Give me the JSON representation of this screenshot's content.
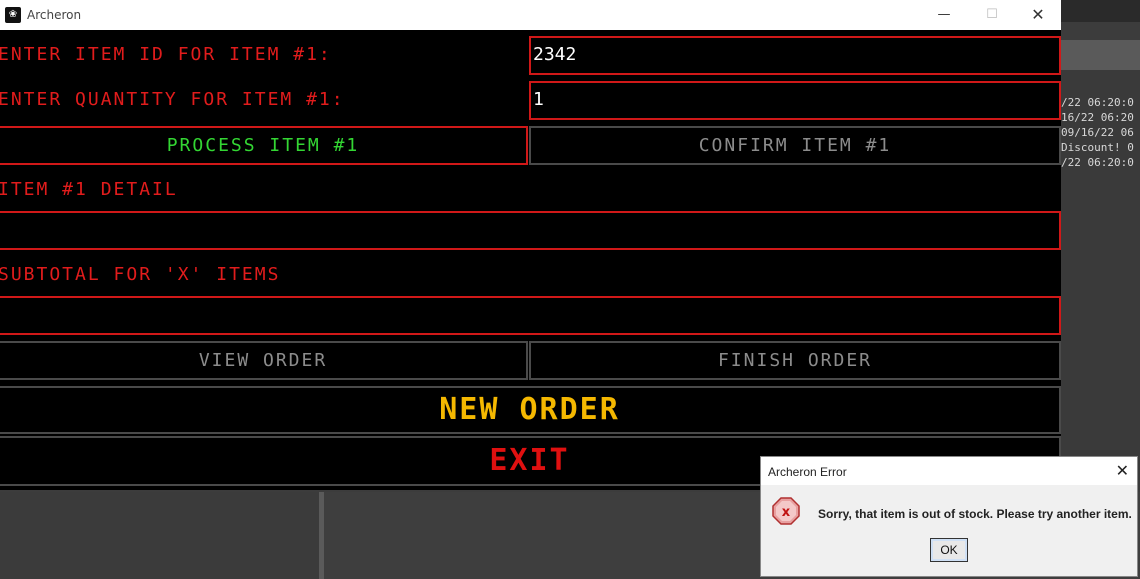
{
  "window": {
    "title": "Archeron",
    "minimize_glyph": "—",
    "maximize_glyph": "☐",
    "close_glyph": "✕",
    "icon": "app-logo-icon"
  },
  "form": {
    "item_id_label": "ENTER ITEM ID FOR ITEM #1:",
    "item_id_value": "2342",
    "quantity_label": "ENTER QUANTITY FOR ITEM #1:",
    "quantity_value": "1",
    "process_button": "PROCESS ITEM #1",
    "confirm_button": "CONFIRM ITEM #1",
    "detail_label": "ITEM #1 DETAIL",
    "detail_value": "",
    "subtotal_label": "SUBTOTAL FOR 'X' ITEMS",
    "subtotal_value": "",
    "view_order_button": "VIEW ORDER",
    "finish_order_button": "FINISH ORDER",
    "new_order_button": "NEW ORDER",
    "exit_button": "EXIT"
  },
  "colors": {
    "label_red": "#e11c1c",
    "process_green": "#33d633",
    "disabled_gray": "#8c8c8c",
    "new_order_yellow": "#f5b800",
    "exit_red": "#e01010"
  },
  "background_log": {
    "lines": [
      "/22 06:20:0",
      "16/22 06:20",
      "09/16/22 06",
      " Discount! 0",
      "/22 06:20:0"
    ]
  },
  "dialog": {
    "title": "Archeron Error",
    "close_glyph": "✕",
    "message": "Sorry, that item is out of stock. Please try another item.",
    "ok_label": "OK",
    "icon": "error-icon",
    "icon_glyph": "x"
  }
}
